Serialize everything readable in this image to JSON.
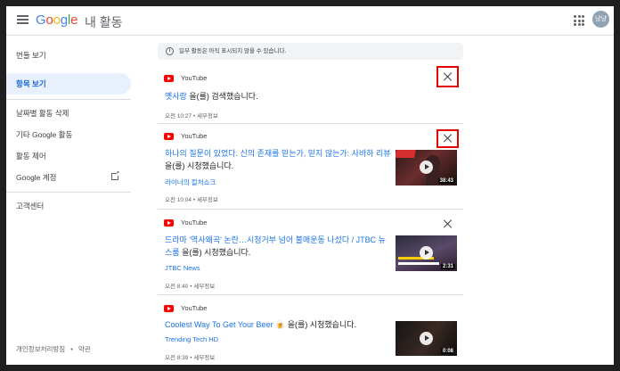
{
  "header": {
    "logo": [
      "G",
      "o",
      "o",
      "g",
      "l",
      "e"
    ],
    "app_title": "내 활동",
    "avatar_text": "냥냥"
  },
  "sidebar": {
    "items": [
      {
        "label": "번들 보기"
      },
      {
        "label": "항목 보기"
      },
      {
        "label": "날짜별 활동 삭제"
      },
      {
        "label": "기타 Google 활동"
      },
      {
        "label": "활동 제어"
      },
      {
        "label": "Google 계정"
      },
      {
        "label": "고객센터"
      }
    ],
    "footer": {
      "privacy": "개인정보처리방침",
      "sep": "•",
      "terms": "약관"
    }
  },
  "notice": {
    "text": "일부 활동은 아직 표시되지 않을 수 있습니다."
  },
  "cards": [
    {
      "source": "YouTube",
      "title_link": "옛사랑",
      "title_suffix": " 을(를) 검색했습니다.",
      "time": "오전 10:27",
      "detail": "세부정보"
    },
    {
      "source": "YouTube",
      "title_link": "하나의 질문이 있었다. 신의 존재를 믿는가, 믿지 않는가: 사바하 리뷰",
      "title_suffix": " 을(를) 시청했습니다.",
      "channel": "라이너의 컬처쇼크",
      "time": "오전 10:04",
      "detail": "세부정보",
      "duration": "38:43"
    },
    {
      "source": "YouTube",
      "title_link": "드라마 '역사왜곡' 논란…시청거부 넘어 불매운동 나섰다 / JTBC 뉴스룸",
      "title_suffix": " 을(를) 시청했습니다.",
      "channel": "JTBC News",
      "time": "오전 8:40",
      "detail": "세부정보",
      "duration": "2:31"
    },
    {
      "source": "YouTube",
      "title_link": "Coolest Way To Get Your Beer 🍺",
      "title_suffix": " 을(를) 시청했습니다.",
      "channel": "Trending Tech HD",
      "time": "오전 8:39",
      "detail": "세부정보",
      "duration": "0:08"
    }
  ],
  "colors": {
    "highlight": "#e00000",
    "link": "#1a73e8",
    "active_nav_bg": "#e8f0fe"
  },
  "icons": [
    "menu-icon",
    "apps-icon",
    "info-icon",
    "youtube-icon",
    "close-icon",
    "open-external-icon",
    "play-icon"
  ]
}
